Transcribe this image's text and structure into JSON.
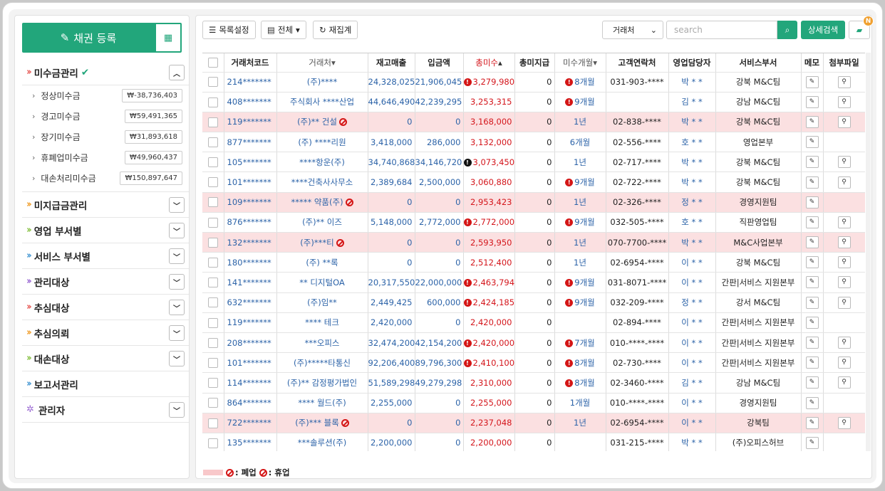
{
  "sidebar": {
    "register_label": "채권 등록",
    "menus": [
      {
        "label": "미수금관리",
        "color": "#e8605c",
        "expanded": true,
        "items": [
          {
            "label": "정상미수금",
            "amount": "₩-38,736,403"
          },
          {
            "label": "경고미수금",
            "amount": "₩59,491,365"
          },
          {
            "label": "장기미수금",
            "amount": "₩31,893,618"
          },
          {
            "label": "휴폐업미수금",
            "amount": "₩49,960,437"
          },
          {
            "label": "대손처리미수금",
            "amount": "₩150,897,647"
          }
        ]
      },
      {
        "label": "미지급금관리",
        "color": "#f0a030"
      },
      {
        "label": "영업 부서별",
        "color": "#8bc34a"
      },
      {
        "label": "서비스 부서별",
        "color": "#4a9ad4"
      },
      {
        "label": "관리대상",
        "color": "#9c6bd4"
      },
      {
        "label": "추심대상",
        "color": "#e8605c"
      },
      {
        "label": "추심의뢰",
        "color": "#f0a030"
      },
      {
        "label": "대손대상",
        "color": "#8bc34a"
      },
      {
        "label": "보고서관리",
        "color": "#4a9ad4"
      },
      {
        "label": "관리자",
        "color": "#9c6bd4"
      }
    ]
  },
  "toolbar": {
    "list_settings": "목록설정",
    "all_label": "전체",
    "recount_label": "재집계",
    "filter_select": "거래처",
    "search_placeholder": "search",
    "advanced_search": "상세검색",
    "badge": "N"
  },
  "table": {
    "headers": [
      "거래처코드",
      "거래처",
      "재고매출",
      "입금액",
      "총미수",
      "총미지급",
      "미수개월",
      "고객연락처",
      "영업담당자",
      "서비스부서",
      "메모",
      "첨부파일"
    ],
    "rows": [
      {
        "code": "214*******",
        "name": "(주)****",
        "sales": "24,328,025",
        "paid": "21,906,045",
        "total": "3,279,980",
        "warn": "red",
        "unpaid": "0",
        "months": "8개월",
        "mwarn": true,
        "phone": "031-903-****",
        "rep": "박 *  *",
        "dept": "강북 M&C팀",
        "pink": false,
        "ban": false,
        "attach": true
      },
      {
        "code": "408*******",
        "name": "주식회사 ****산업",
        "sales": "44,646,490",
        "paid": "42,239,295",
        "total": "3,253,315",
        "warn": "",
        "unpaid": "0",
        "months": "9개월",
        "mwarn": true,
        "phone": "",
        "rep": "김 *  *",
        "dept": "강남 M&C팀",
        "pink": false,
        "ban": false,
        "attach": true
      },
      {
        "code": "119*******",
        "name": "(주)** 건설",
        "sales": "0",
        "paid": "0",
        "total": "3,168,000",
        "warn": "",
        "unpaid": "0",
        "months": "1년",
        "mwarn": false,
        "phone": "02-838-****",
        "rep": "박 *  *",
        "dept": "강북 M&C팀",
        "pink": true,
        "ban": true,
        "attach": true
      },
      {
        "code": "877*******",
        "name": "(주) ****리원",
        "sales": "3,418,000",
        "paid": "286,000",
        "total": "3,132,000",
        "warn": "",
        "unpaid": "0",
        "months": "6개월",
        "mwarn": false,
        "phone": "02-556-****",
        "rep": "호 *  *",
        "dept": "영업본부",
        "pink": false,
        "ban": false,
        "attach": false
      },
      {
        "code": "105*******",
        "name": "****항운(주)",
        "sales": "34,740,868",
        "paid": "34,146,720",
        "total": "3,073,450",
        "warn": "black",
        "unpaid": "0",
        "months": "1년",
        "mwarn": false,
        "phone": "02-717-****",
        "rep": "박 *  *",
        "dept": "강북 M&C팀",
        "pink": false,
        "ban": false,
        "attach": true
      },
      {
        "code": "101*******",
        "name": "****건축사사무소",
        "sales": "2,389,684",
        "paid": "2,500,000",
        "total": "3,060,880",
        "warn": "",
        "unpaid": "0",
        "months": "9개월",
        "mwarn": true,
        "phone": "02-722-****",
        "rep": "박 *  *",
        "dept": "강북 M&C팀",
        "pink": false,
        "ban": false,
        "attach": true
      },
      {
        "code": "109*******",
        "name": "***** 약품(주)",
        "sales": "0",
        "paid": "0",
        "total": "2,953,423",
        "warn": "",
        "unpaid": "0",
        "months": "1년",
        "mwarn": false,
        "phone": "02-326-****",
        "rep": "정 *  *",
        "dept": "경영지원팀",
        "pink": true,
        "ban": true,
        "attach": false
      },
      {
        "code": "876*******",
        "name": "(주)** 이즈",
        "sales": "5,148,000",
        "paid": "2,772,000",
        "total": "2,772,000",
        "warn": "red",
        "unpaid": "0",
        "months": "9개월",
        "mwarn": true,
        "phone": "032-505-****",
        "rep": "호 *  *",
        "dept": "직판영업팀",
        "pink": false,
        "ban": false,
        "attach": true
      },
      {
        "code": "132*******",
        "name": "(주)***티",
        "sales": "0",
        "paid": "0",
        "total": "2,593,950",
        "warn": "",
        "unpaid": "0",
        "months": "1년",
        "mwarn": false,
        "phone": "070-7700-****",
        "rep": "박 *  *",
        "dept": "M&C사업본부",
        "pink": true,
        "ban": true,
        "attach": true
      },
      {
        "code": "180*******",
        "name": "(주) **록",
        "sales": "0",
        "paid": "0",
        "total": "2,512,400",
        "warn": "",
        "unpaid": "0",
        "months": "1년",
        "mwarn": false,
        "phone": "02-6954-****",
        "rep": "이 *  *",
        "dept": "강북 M&C팀",
        "pink": false,
        "ban": false,
        "attach": true
      },
      {
        "code": "141*******",
        "name": "** 디지털OA",
        "sales": "20,317,550",
        "paid": "22,000,000",
        "total": "2,463,794",
        "warn": "red",
        "unpaid": "0",
        "months": "9개월",
        "mwarn": true,
        "phone": "031-8071-****",
        "rep": "이 *  *",
        "dept": "간판|서비스 지원본부",
        "pink": false,
        "ban": false,
        "attach": true
      },
      {
        "code": "632*******",
        "name": "(주)임**",
        "sales": "2,449,425",
        "paid": "600,000",
        "total": "2,424,185",
        "warn": "red",
        "unpaid": "0",
        "months": "9개월",
        "mwarn": true,
        "phone": "032-209-****",
        "rep": "정 *  *",
        "dept": "강서 M&C팀",
        "pink": false,
        "ban": false,
        "attach": true
      },
      {
        "code": "119*******",
        "name": "**** 테크",
        "sales": "2,420,000",
        "paid": "0",
        "total": "2,420,000",
        "warn": "",
        "unpaid": "0",
        "months": "",
        "mwarn": false,
        "phone": "02-894-****",
        "rep": "이 *  *",
        "dept": "간판|서비스 지원본부",
        "pink": false,
        "ban": false,
        "attach": false
      },
      {
        "code": "208*******",
        "name": "***오피스",
        "sales": "32,474,200",
        "paid": "42,154,200",
        "total": "2,420,000",
        "warn": "red",
        "unpaid": "0",
        "months": "7개월",
        "mwarn": true,
        "phone": "010-****-****",
        "rep": "이 *  *",
        "dept": "간판|서비스 지원본부",
        "pink": false,
        "ban": false,
        "attach": true
      },
      {
        "code": "101*******",
        "name": "(주)*****타통신",
        "sales": "92,206,400",
        "paid": "89,796,300",
        "total": "2,410,100",
        "warn": "red",
        "unpaid": "0",
        "months": "8개월",
        "mwarn": true,
        "phone": "02-730-****",
        "rep": "이 *  *",
        "dept": "간판|서비스 지원본부",
        "pink": false,
        "ban": false,
        "attach": true
      },
      {
        "code": "114*******",
        "name": "(주)** 감정평가법인",
        "sales": "51,589,298",
        "paid": "49,279,298",
        "total": "2,310,000",
        "warn": "",
        "unpaid": "0",
        "months": "8개월",
        "mwarn": true,
        "phone": "02-3460-****",
        "rep": "김 *  *",
        "dept": "강남 M&C팀",
        "pink": false,
        "ban": false,
        "attach": true
      },
      {
        "code": "864*******",
        "name": "**** 월드(주)",
        "sales": "2,255,000",
        "paid": "0",
        "total": "2,255,000",
        "warn": "",
        "unpaid": "0",
        "months": "1개월",
        "mwarn": false,
        "phone": "010-****-****",
        "rep": "이 *  *",
        "dept": "경영지원팀",
        "pink": false,
        "ban": false,
        "attach": false
      },
      {
        "code": "722*******",
        "name": "(주)*** 블록",
        "sales": "0",
        "paid": "0",
        "total": "2,237,048",
        "warn": "",
        "unpaid": "0",
        "months": "1년",
        "mwarn": false,
        "phone": "02-6954-****",
        "rep": "이 *  *",
        "dept": "강북팀",
        "pink": true,
        "ban": true,
        "attach": true
      },
      {
        "code": "135*******",
        "name": "***솔루션(주)",
        "sales": "2,200,000",
        "paid": "0",
        "total": "2,200,000",
        "warn": "",
        "unpaid": "0",
        "months": "",
        "mwarn": false,
        "phone": "031-215-****",
        "rep": "박 *  *",
        "dept": "(주)오피스허브",
        "pink": false,
        "ban": false,
        "attach": false
      }
    ]
  },
  "legend": {
    "closed_label": ": 폐업",
    "suspended_label": ": 휴업"
  }
}
